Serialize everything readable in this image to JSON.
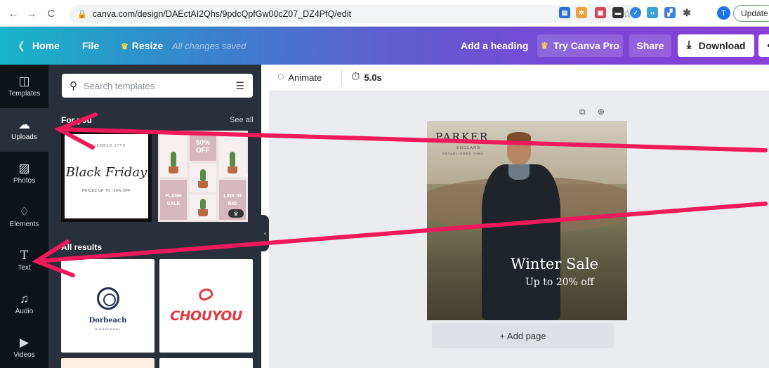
{
  "browser": {
    "url": "canva.com/design/DAEctAI2Qhs/9pdcQpfGw00cZ07_DZ4PfQ/edit",
    "profile_initial": "T",
    "update_label": "Update"
  },
  "topbar": {
    "home": "Home",
    "file": "File",
    "resize": "Resize",
    "saved_status": "All changes saved",
    "add_heading": "Add a heading",
    "try_pro": "Try Canva Pro",
    "share": "Share",
    "download": "Download"
  },
  "rail": {
    "items": [
      {
        "label": "Templates",
        "icon": "templates-icon"
      },
      {
        "label": "Uploads",
        "icon": "upload-cloud-icon"
      },
      {
        "label": "Photos",
        "icon": "photos-icon"
      },
      {
        "label": "Elements",
        "icon": "elements-icon"
      },
      {
        "label": "Text",
        "icon": "text-icon"
      },
      {
        "label": "Audio",
        "icon": "audio-icon"
      },
      {
        "label": "Videos",
        "icon": "videos-icon"
      }
    ]
  },
  "panel": {
    "search_placeholder": "Search templates",
    "for_you": "For you",
    "see_all": "See all",
    "all_results": "All results",
    "black_friday": {
      "top": "NOVEMBER 27TH",
      "title": "Black Friday",
      "sub": "PRICES UP TO -50% OFF"
    },
    "cactus": {
      "badge": "50% OFF",
      "flash": "FLASH SALE",
      "link": "LINK IN BIO"
    },
    "dorbeach": {
      "name": "Dorbeach",
      "tag": "HIGHSCHOOL"
    },
    "chouyou": {
      "name": "CHOUYOU"
    }
  },
  "editor": {
    "animate": "Animate",
    "duration": "5.0s",
    "design": {
      "brand": "PARKER",
      "brand_sub": "ENGLAND",
      "brand_sub2": "ESTABLISHED 1985",
      "headline": "Winter Sale",
      "subline": "Up to 20% off"
    },
    "add_page": "+ Add page"
  },
  "colors": {
    "rail_bg": "#0e1318",
    "panel_bg": "#293039",
    "arrow": "#f0195c",
    "accent_crown": "#ffd44b"
  }
}
